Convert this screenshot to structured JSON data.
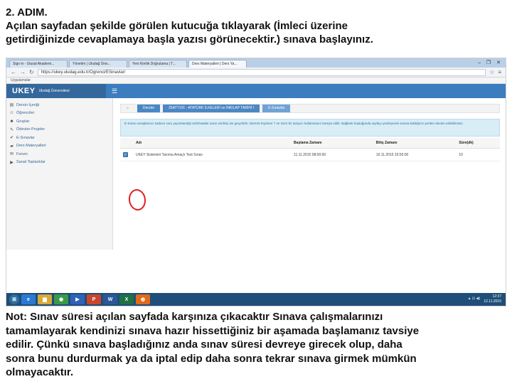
{
  "heading": {
    "title": "2. ADIM.",
    "line1": "Açılan sayfadan şekilde görülen kutucuğa tıklayarak (İmleci üzerine",
    "line2": "getirdiğinizde cevaplamaya başla yazısı görünecektir.) sınava başlayınız."
  },
  "browser": {
    "tabs": [
      "Sign in - Ulusal Akademi...",
      "Yönetim | Uludağ Üniv...",
      "Yeni Kimlik Doğrulama | T...",
      "Ders Materyalleri | Ders Ya..."
    ],
    "address": "https://ukey.uludag.edu.tr/Ogrenci/ESinavlar/",
    "bookmarks": "Uygulamalar",
    "controls": "–  ❐  ✕"
  },
  "app": {
    "logo": "UKEY",
    "logo_sub": "Uludağ Üniversitesi",
    "sidebar": [
      {
        "icon": "book-icon",
        "glyph": "▤",
        "label": "Dersin İçeriği"
      },
      {
        "icon": "users-icon",
        "glyph": "☺",
        "label": "Öğrenciler"
      },
      {
        "icon": "group-icon",
        "glyph": "☻",
        "label": "Gruplar"
      },
      {
        "icon": "edit-icon",
        "glyph": "✎",
        "label": "Ödevler-Projeler"
      },
      {
        "icon": "exam-icon",
        "glyph": "✔",
        "label": "E-Sınavlar"
      },
      {
        "icon": "folder-icon",
        "glyph": "▰",
        "label": "Ders Materyalleri"
      },
      {
        "icon": "forum-icon",
        "glyph": "✉",
        "label": "Forum"
      },
      {
        "icon": "video-icon",
        "glyph": "▶",
        "label": "Sanal Toplantılar"
      }
    ],
    "breadcrumb": [
      "Dersler",
      "25ATT101 - ATATÜRK İLKELERİ ve İNKILAP TARİHİ I",
      "E-Sınavlar"
    ],
    "info": "E-Sınav cevaplarınız sadece soru yayımlandığı tarih/saatler arası verilmiş ise geçerlidir. Internet Explorer 7 ve üzeri bir tarayıcı kullanmanız tavsiye edilir. Bağlantı koptuğunda sayfayı yenileyerek sınava kaldığınız yerden devam edebilirsiniz.",
    "table": {
      "headers": [
        "",
        "Adı",
        "Başlama Zamanı",
        "Bitiş Zamanı",
        "Süre(dk)"
      ],
      "rows": [
        {
          "name": "UKEY Sistemini Tanıma Amaçlı Test Sınav",
          "start": "11.11.2015 08:00:00",
          "end": "16.11.2015 15:55:00",
          "duration": "10"
        }
      ]
    }
  },
  "taskbar": {
    "apps": [
      {
        "name": "ie",
        "glyph": "e",
        "color": "#2a7ad4"
      },
      {
        "name": "explorer",
        "glyph": "▆",
        "color": "#d8a93a"
      },
      {
        "name": "chrome",
        "glyph": "◉",
        "color": "#3a9a48"
      },
      {
        "name": "media",
        "glyph": "▶",
        "color": "#3062b8"
      },
      {
        "name": "powerpoint",
        "glyph": "P",
        "color": "#c8462b"
      },
      {
        "name": "word",
        "glyph": "W",
        "color": "#2b5797"
      },
      {
        "name": "excel",
        "glyph": "X",
        "color": "#1e7145"
      },
      {
        "name": "firefox",
        "glyph": "◍",
        "color": "#e06a1b"
      }
    ],
    "tray": "▲ ⊡ ◀)",
    "time": "12:37",
    "date": "12.11.2015"
  },
  "note": {
    "line1": "Not: Sınav süresi açılan sayfada karşınıza çıkacaktır Sınava çalışmalarınızı",
    "line2": "tamamlayarak kendinizi sınava hazır hissettiğiniz bir aşamada başlamanız tavsiye",
    "line3": "edilir. Çünkü sınava başladığınız anda sınav süresi devreye girecek olup, daha",
    "line4": "sonra bunu durdurmak ya da iptal edip daha sonra tekrar sınava girmek mümkün",
    "line5": "olmayacaktır."
  }
}
